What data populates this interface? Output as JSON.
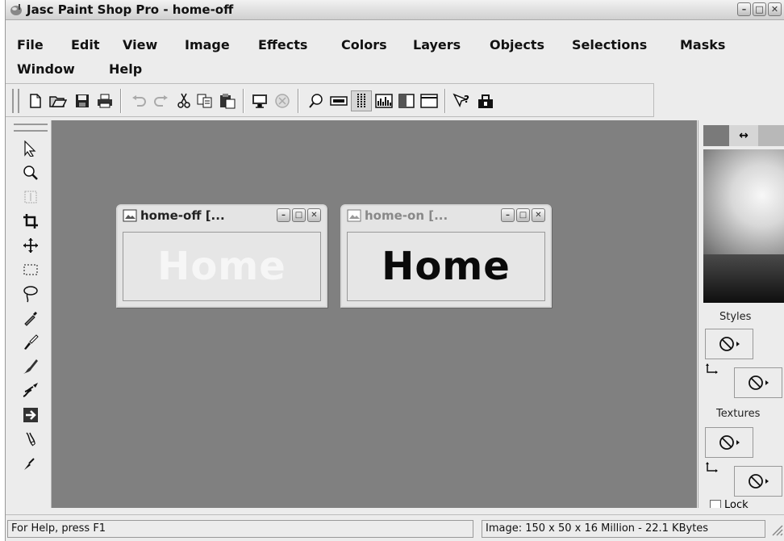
{
  "window": {
    "title": "Jasc Paint Shop Pro - home-off"
  },
  "menu": {
    "row1": [
      "File",
      "Edit",
      "View",
      "Image",
      "Effects",
      "Colors",
      "Layers",
      "Objects",
      "Selections",
      "Masks"
    ],
    "row2": [
      "Window",
      "Help"
    ]
  },
  "toolbar_icons": [
    "new-icon",
    "open-icon",
    "save-icon",
    "print-icon",
    "undo-icon",
    "redo-icon",
    "cut-icon",
    "copy-icon",
    "paste-icon",
    "full-screen-preview-icon",
    "browse-icon",
    "overview-icon",
    "toolbar-icon",
    "tool-palette-icon",
    "histogram-icon",
    "layer-palette-icon",
    "tool-options-icon",
    "help-icon",
    "color-replacer-icon"
  ],
  "tool_palette_icons": [
    "arrow-icon",
    "zoom-icon",
    "deformation-icon",
    "crop-icon",
    "mover-icon",
    "selection-icon",
    "freehand-icon",
    "dropper-icon",
    "paintbrush-icon",
    "clone-brush-icon",
    "color-replacer-icon",
    "retouch-icon",
    "scratch-remover-icon",
    "eraser-icon"
  ],
  "documents": [
    {
      "title": "home-off [...",
      "content": "Home",
      "state": "active"
    },
    {
      "title": "home-on [...",
      "content": "Home",
      "state": "inactive"
    }
  ],
  "panel": {
    "styles_label": "Styles",
    "textures_label": "Textures",
    "lock_label": "Lock"
  },
  "status": {
    "help": "For Help, press F1",
    "image_info": "Image:  150 x 50 x 16 Million - 22.1 KBytes"
  }
}
